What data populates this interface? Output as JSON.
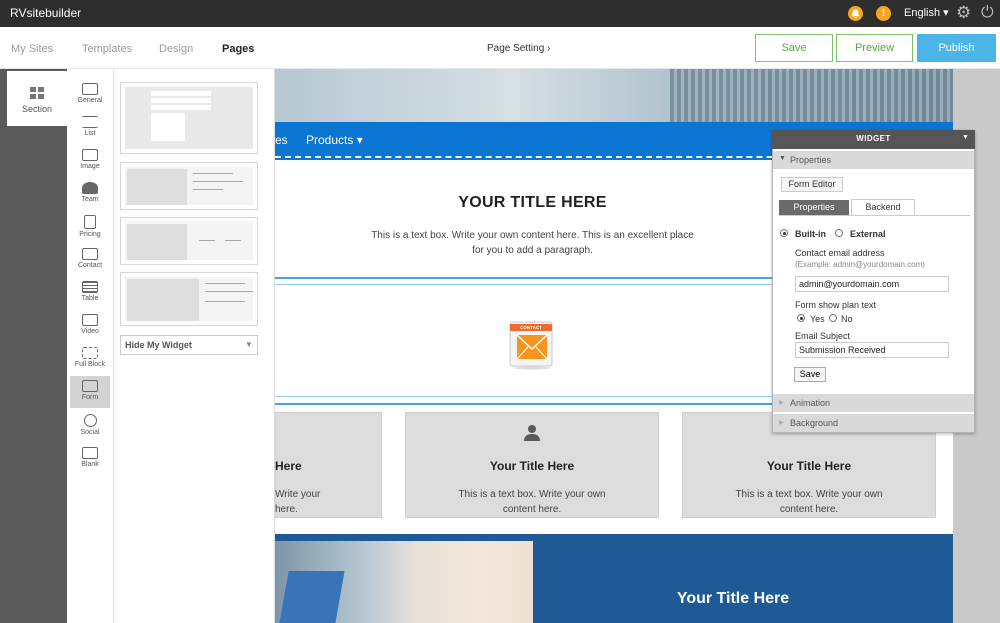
{
  "topbar": {
    "brand": "RVsitebuilder",
    "language": "English ▾",
    "bell_icon": "bell-icon",
    "alert_icon": "alert-icon",
    "alert_glyph": "!"
  },
  "nav": {
    "links": [
      "My Sites",
      "Templates",
      "Design",
      "Pages"
    ],
    "active": "Pages",
    "page_setting": "Page Setting ›",
    "save": "Save",
    "preview": "Preview",
    "publish": "Publish"
  },
  "sidebar": {
    "section": "Section"
  },
  "widgets": [
    "General",
    "List",
    "Image",
    "Team",
    "Pricing",
    "Contact",
    "Table",
    "Video",
    "Full Block",
    "Form",
    "Social",
    "Blank"
  ],
  "widget_active": "Form",
  "templates": {
    "hide_widget": "Hide My Widget"
  },
  "canvas": {
    "nav_partial": "es",
    "nav_products": "Products ▾",
    "title": "YOUR TITLE HERE",
    "text": "This is a text box. Write your own content here. This is an excellent place for you to add a paragraph.",
    "contact_badge": "CONTACT",
    "card_left_title": "Here",
    "card_left_text": "Write your here.",
    "card_mid_title": "Your Title Here",
    "card_mid_text": "This is a text box. Write your own content here.",
    "card_right_title": "Your Title Here",
    "card_right_text": "This is a text box. Write your own content here.",
    "band_title": "Your Title Here"
  },
  "widget_panel": {
    "title": "WIDGET",
    "properties": "Properties",
    "form_editor": "Form Editor",
    "tab_properties": "Properties",
    "tab_backend": "Backend",
    "builtin": "Built-in",
    "external": "External",
    "email_label": "Contact email address",
    "email_hint": "(Example: admin@yourdomain.com)",
    "email_value": "admin@yourdomain.com",
    "plan_label": "Form show plan text",
    "yes": "Yes",
    "no": "No",
    "subject_label": "Email Subject",
    "subject_value": "Submission Received",
    "save": "Save",
    "animation": "Animation",
    "background": "Background"
  },
  "colors": {
    "accent_blue": "#0b76d1",
    "publish": "#4bb5e8",
    "save_green": "#5aa64a",
    "alert": "#f5a623"
  }
}
